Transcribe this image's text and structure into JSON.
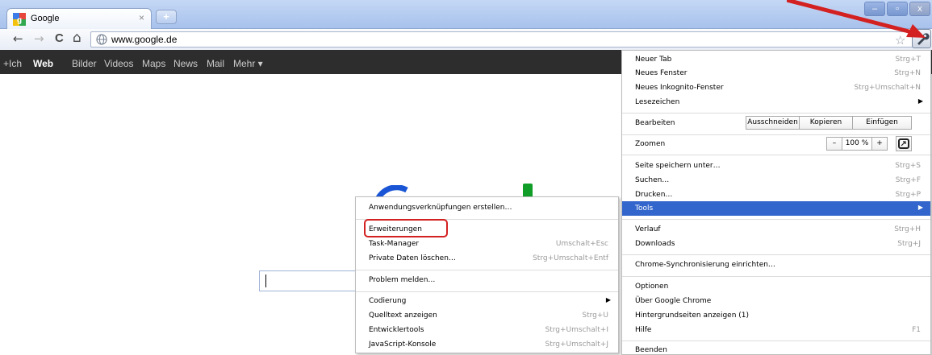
{
  "browser": {
    "tab_title": "Google",
    "tab_close": "×",
    "new_tab": "+",
    "window_controls": {
      "minimize": "–",
      "maximize": "▫",
      "close": "x"
    },
    "nav": {
      "back": "←",
      "forward": "→",
      "reload": "C",
      "home": "⌂"
    },
    "url": "www.google.de",
    "star": "☆",
    "icons": {
      "back": "back-arrow-icon",
      "forward": "forward-arrow-icon",
      "reload": "reload-icon",
      "home": "home-icon",
      "globe": "globe-icon",
      "star": "star-icon",
      "wrench": "wrench-icon"
    }
  },
  "gbar": {
    "items": [
      "+Ich",
      "Web",
      "Bilder",
      "Videos",
      "Maps",
      "News",
      "Mail",
      "Mehr ▾"
    ],
    "active": "Web"
  },
  "wrench_menu": {
    "new_tab": {
      "label": "Neuer Tab",
      "shortcut": "Strg+T"
    },
    "new_window": {
      "label": "Neues Fenster",
      "shortcut": "Strg+N"
    },
    "incognito": {
      "label": "Neues Inkognito-Fenster",
      "shortcut": "Strg+Umschalt+N"
    },
    "bookmarks": {
      "label": "Lesezeichen",
      "arrow": "▶"
    },
    "edit": {
      "label": "Bearbeiten",
      "cut": "Ausschneiden",
      "copy": "Kopieren",
      "paste": "Einfügen"
    },
    "zoom": {
      "label": "Zoomen",
      "minus": "–",
      "value": "100 %",
      "plus": "+"
    },
    "save_page": {
      "label": "Seite speichern unter…",
      "shortcut": "Strg+S"
    },
    "find": {
      "label": "Suchen…",
      "shortcut": "Strg+F"
    },
    "print": {
      "label": "Drucken…",
      "shortcut": "Strg+P"
    },
    "tools": {
      "label": "Tools",
      "arrow": "▶"
    },
    "history": {
      "label": "Verlauf",
      "shortcut": "Strg+H"
    },
    "downloads": {
      "label": "Downloads",
      "shortcut": "Strg+J"
    },
    "sync": {
      "label": "Chrome-Synchronisierung einrichten…"
    },
    "options": {
      "label": "Optionen"
    },
    "about": {
      "label": "Über Google Chrome"
    },
    "background_pages": {
      "label": "Hintergrundseiten anzeigen (1)"
    },
    "help": {
      "label": "Hilfe",
      "shortcut": "F1"
    },
    "exit": {
      "label": "Beenden"
    }
  },
  "tools_menu": {
    "create_shortcuts": {
      "label": "Anwendungsverknüpfungen erstellen…"
    },
    "extensions": {
      "label": "Erweiterungen"
    },
    "task_manager": {
      "label": "Task-Manager",
      "shortcut": "Umschalt+Esc"
    },
    "clear_data": {
      "label": "Private Daten löschen…",
      "shortcut": "Strg+Umschalt+Entf"
    },
    "report_issue": {
      "label": "Problem melden…"
    },
    "encoding": {
      "label": "Codierung",
      "arrow": "▶"
    },
    "view_source": {
      "label": "Quelltext anzeigen",
      "shortcut": "Strg+U"
    },
    "dev_tools": {
      "label": "Entwicklertools",
      "shortcut": "Strg+Umschalt+I"
    },
    "js_console": {
      "label": "JavaScript-Konsole",
      "shortcut": "Strg+Umschalt+J"
    }
  },
  "colors": {
    "highlight": "#3366cc",
    "annotation": "#d32020",
    "gbar": "#2d2d2d"
  }
}
